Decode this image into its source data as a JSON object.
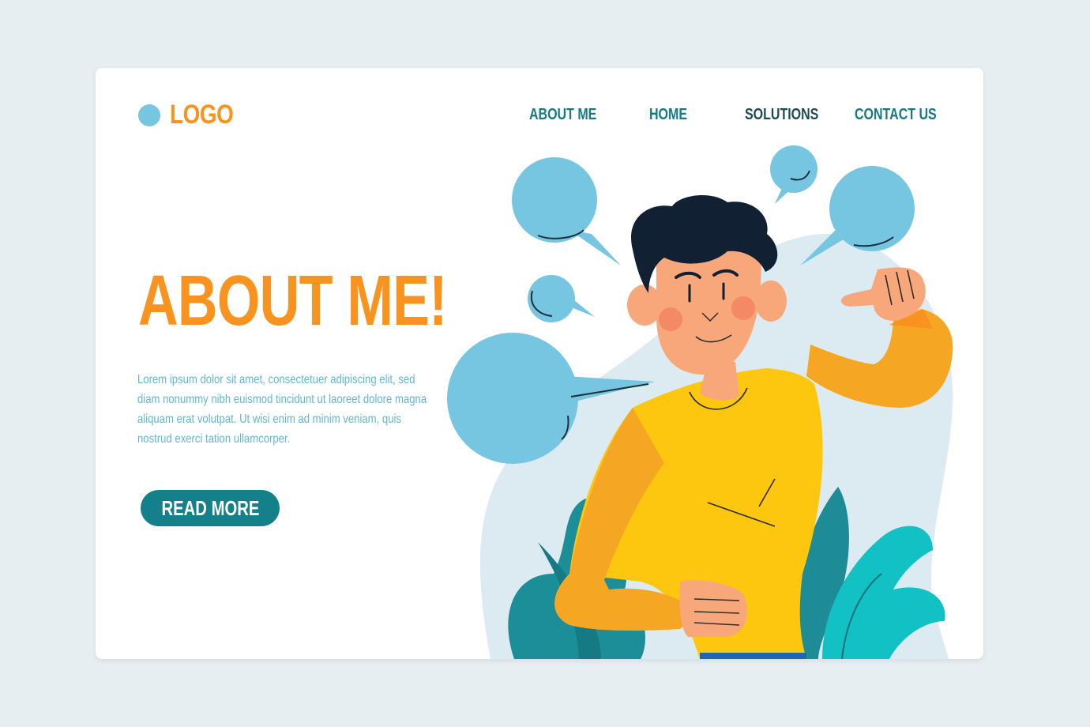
{
  "brand": {
    "logo_text": "LOGO"
  },
  "nav": {
    "items": [
      {
        "label": "ABOUT ME"
      },
      {
        "label": "HOME"
      },
      {
        "label": "SOLUTIONS"
      },
      {
        "label": "CONTACT US"
      }
    ]
  },
  "hero": {
    "title": "ABOUT ME!",
    "body": "Lorem ipsum dolor sit amet, consectetuer adipiscing elit, sed diam nonummy nibh euismod tincidunt ut laoreet dolore magna aliquam erat volutpat. Ut wisi enim ad minim veniam, quis nostrud exerci tation ullamcorper.",
    "cta_label": "READ MORE"
  },
  "colors": {
    "accent_orange": "#f7931e",
    "teal": "#14818a",
    "bubble_blue": "#76c6e1",
    "background": "#e6eef1"
  }
}
